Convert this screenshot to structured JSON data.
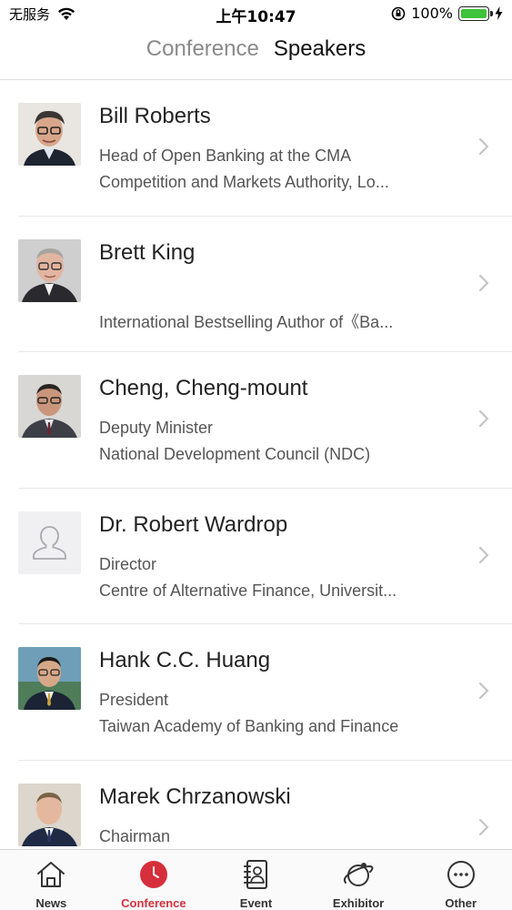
{
  "status_bar": {
    "carrier": "无服务",
    "time": "上午10:47",
    "battery": "100%",
    "wifi_icon": "wifi-icon",
    "battery_level": 1.0
  },
  "header": {
    "tabs": [
      {
        "label": "Conference",
        "active": false
      },
      {
        "label": "Speakers",
        "active": true
      }
    ]
  },
  "speakers": [
    {
      "name": "Bill Roberts",
      "line1": "Head of Open Banking at the CMA",
      "line2": "Competition and Markets Authority, Lo..."
    },
    {
      "name": "Brett King",
      "line1": "",
      "line2": "International Bestselling Author of《Ba..."
    },
    {
      "name": "Cheng, Cheng-mount",
      "line1": "Deputy Minister",
      "line2": "National Development Council (NDC)"
    },
    {
      "name": "Dr. Robert Wardrop",
      "line1": "Director",
      "line2": "Centre of Alternative Finance, Universit..."
    },
    {
      "name": "Hank C.C. Huang",
      "line1": "President",
      "line2": "Taiwan Academy of Banking and Finance"
    },
    {
      "name": "Marek Chrzanowski",
      "line1": "Chairman",
      "line2": ""
    }
  ],
  "bottom_nav": {
    "items": [
      {
        "label": "News",
        "icon": "house-icon"
      },
      {
        "label": "Conference",
        "icon": "clock-icon"
      },
      {
        "label": "Event",
        "icon": "notebook-person-icon"
      },
      {
        "label": "Exhibitor",
        "icon": "planet-icon"
      },
      {
        "label": "Other",
        "icon": "more-dots-icon"
      }
    ],
    "active_color": "#d62f3c"
  }
}
